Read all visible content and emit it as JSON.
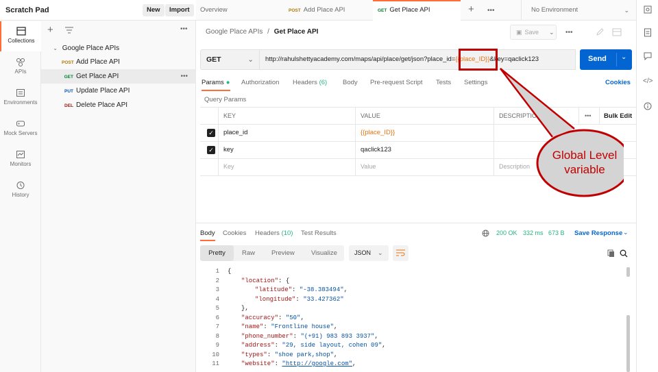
{
  "workspace": {
    "title": "Scratch Pad",
    "new_label": "New",
    "import_label": "Import"
  },
  "rail": [
    {
      "label": "Collections",
      "icon": "collections-icon"
    },
    {
      "label": "APIs",
      "icon": "apis-icon"
    },
    {
      "label": "Environments",
      "icon": "environments-icon"
    },
    {
      "label": "Mock Servers",
      "icon": "mock-servers-icon"
    },
    {
      "label": "Monitors",
      "icon": "monitors-icon"
    },
    {
      "label": "History",
      "icon": "history-icon"
    }
  ],
  "collection": {
    "name": "Google Place APIs",
    "requests": [
      {
        "method": "POST",
        "name": "Add Place API"
      },
      {
        "method": "GET",
        "name": "Get Place API"
      },
      {
        "method": "PUT",
        "name": "Update Place API"
      },
      {
        "method": "DEL",
        "name": "Delete Place API"
      }
    ]
  },
  "tabs": [
    {
      "label": "Overview"
    },
    {
      "method": "POST",
      "label": "Add Place API"
    },
    {
      "method": "GET",
      "label": "Get Place API"
    }
  ],
  "environment": "No Environment",
  "breadcrumb": {
    "parent": "Google Place APIs",
    "sep": "/",
    "current": "Get Place API"
  },
  "save_label": "Save",
  "request": {
    "method": "GET",
    "url_prefix": "http://rahulshettyacademy.com/maps/api/place/get/json?place_id=",
    "url_var": "{{place_ID}}",
    "url_suffix": "&key=qaclick123",
    "send_label": "Send"
  },
  "request_tabs": [
    "Params",
    "Authorization",
    "Headers",
    "(6)",
    "Body",
    "Pre-request Script",
    "Tests",
    "Settings"
  ],
  "cookies_label": "Cookies",
  "query_params": {
    "title": "Query Params",
    "headers": [
      "KEY",
      "VALUE",
      "DESCRIPTION",
      "Bulk Edit"
    ],
    "rows": [
      {
        "key": "place_id",
        "value": "{{place_ID}}"
      },
      {
        "key": "key",
        "value": "qaclick123"
      }
    ],
    "placeholder": {
      "key": "Key",
      "value": "Value",
      "description": "Description"
    }
  },
  "callout": {
    "line1": "Global Level",
    "line2": "variable"
  },
  "response_tabs": [
    "Body",
    "Cookies",
    "Headers",
    "(10)",
    "Test Results"
  ],
  "response_status": {
    "status": "200 OK",
    "time": "332 ms",
    "size": "673 B",
    "save_label": "Save Response"
  },
  "body_views": [
    "Pretty",
    "Raw",
    "Preview",
    "Visualize"
  ],
  "format": "JSON",
  "code_lines": [
    {
      "n": "1",
      "t": "{"
    },
    {
      "n": "2",
      "k": "\"location\"",
      "t": ": {"
    },
    {
      "n": "3",
      "k": "\"latitude\"",
      "t": ": ",
      "v": "\"-38.383494\"",
      "e": ","
    },
    {
      "n": "4",
      "k": "\"longitude\"",
      "t": ": ",
      "v": "\"33.427362\""
    },
    {
      "n": "5",
      "t": "},"
    },
    {
      "n": "6",
      "k": "\"accuracy\"",
      "t": ": ",
      "v": "\"50\"",
      "e": ","
    },
    {
      "n": "7",
      "k": "\"name\"",
      "t": ": ",
      "v": "\"Frontline house\"",
      "e": ","
    },
    {
      "n": "8",
      "k": "\"phone_number\"",
      "t": ": ",
      "v": "\"(+91) 983 893 3937\"",
      "e": ","
    },
    {
      "n": "9",
      "k": "\"address\"",
      "t": ": ",
      "v": "\"29, side layout, cohen 09\"",
      "e": ","
    },
    {
      "n": "10",
      "k": "\"types\"",
      "t": ": ",
      "v": "\"shoe park,shop\"",
      "e": ","
    },
    {
      "n": "11",
      "k": "\"website\"",
      "t": ": ",
      "v": "\"http://google.com\"",
      "e": ","
    }
  ],
  "colors": {
    "accent": "#ff6c37",
    "send": "#0265d2",
    "callout": "#c00000",
    "get": "#007f31",
    "post": "#ad7a03",
    "put": "#0053b8",
    "del": "#8e1a10"
  }
}
